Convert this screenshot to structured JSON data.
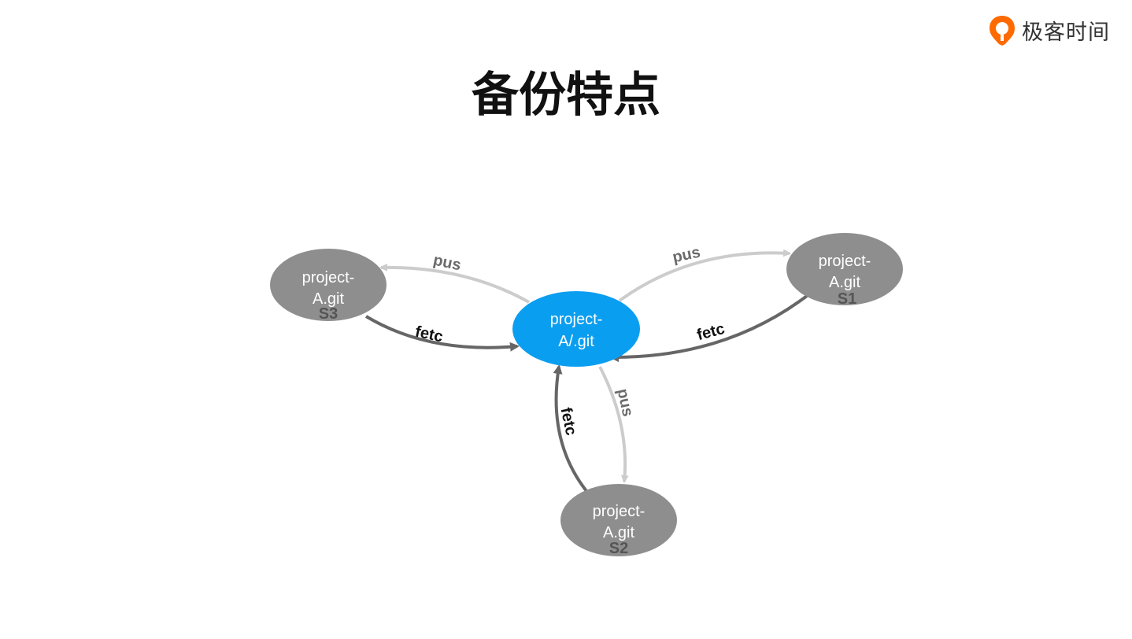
{
  "brand": {
    "name": "极客时间",
    "accent": "#ff6a00"
  },
  "title": "备份特点",
  "colors": {
    "center": "#0a9ef0",
    "replica": "#8e8e8e",
    "push_edge": "#cccccc",
    "fetch_edge": "#666666"
  },
  "nodes": {
    "center": {
      "line1": "project-",
      "line2": "A/.git"
    },
    "s1": {
      "line1": "project-",
      "line2": "A.git",
      "tag": "S1"
    },
    "s2": {
      "line1": "project-",
      "line2": "A.git",
      "tag": "S2"
    },
    "s3": {
      "line1": "project-",
      "line2": "A.git",
      "tag": "S3"
    }
  },
  "edges": {
    "push_s1": "pus",
    "fetch_s1": "fetc",
    "push_s2": "pus",
    "fetch_s2": "fetc",
    "push_s3": "pus",
    "fetch_s3": "fetc"
  }
}
